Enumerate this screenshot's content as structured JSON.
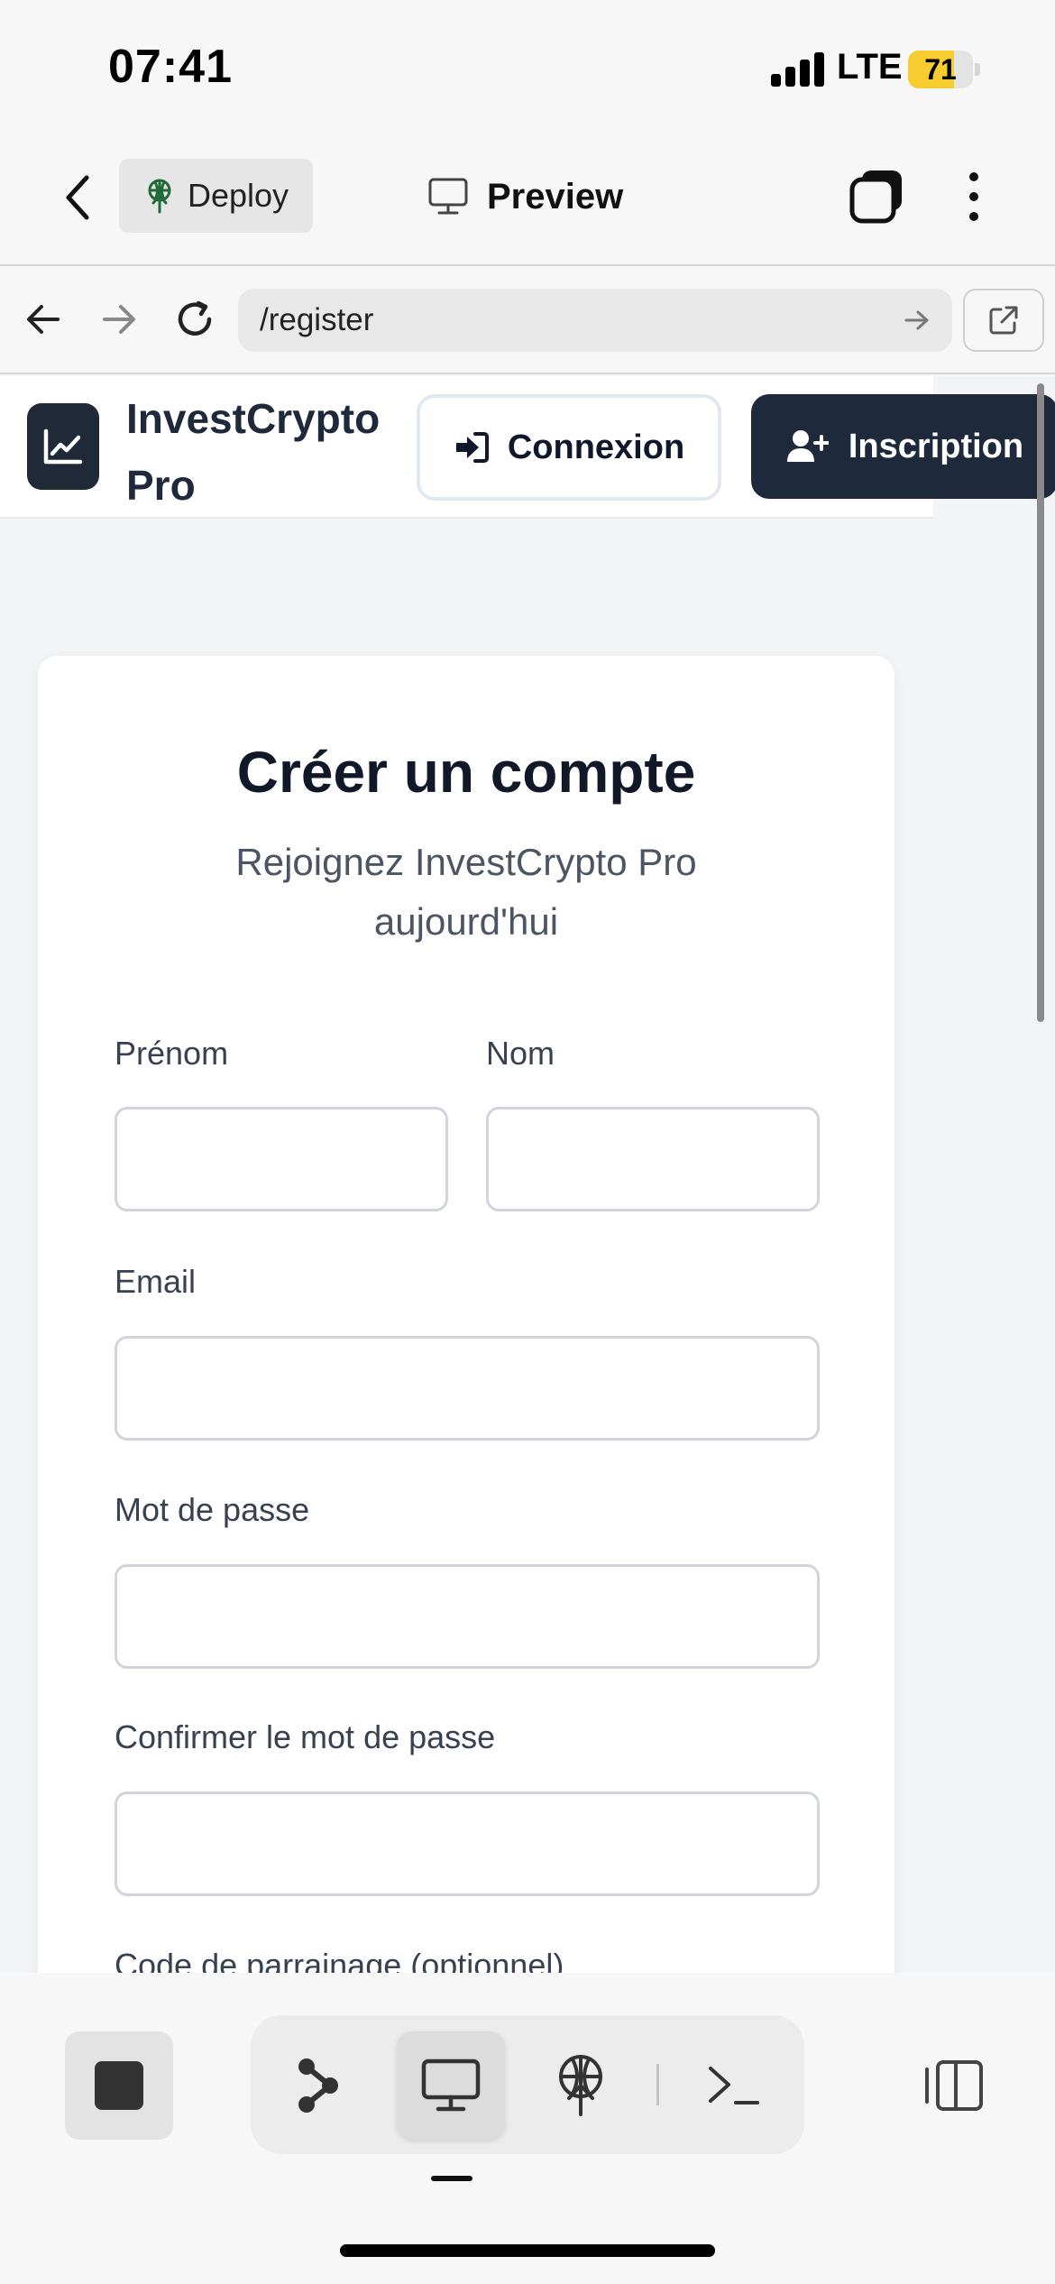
{
  "status_bar": {
    "time": "07:41",
    "network": "LTE",
    "battery_level": "71"
  },
  "app_header": {
    "deploy_label": "Deploy",
    "preview_label": "Preview"
  },
  "browser": {
    "url": "/register"
  },
  "site": {
    "brand_line1": "InvestCrypto",
    "brand_line2": "Pro",
    "login_label": "Connexion",
    "signup_label": "Inscription"
  },
  "form": {
    "title": "Créer un compte",
    "subtitle_line1": "Rejoignez InvestCrypto Pro",
    "subtitle_line2": "aujourd'hui",
    "first_name_label": "Prénom",
    "last_name_label": "Nom",
    "email_label": "Email",
    "password_label": "Mot de passe",
    "confirm_password_label": "Confirmer le mot de passe",
    "referral_label": "Code de parrainage (optionnel)",
    "first_name_value": "",
    "last_name_value": "",
    "email_value": "",
    "password_value": "",
    "confirm_password_value": ""
  },
  "colors": {
    "accent_dark": "#1e293b",
    "battery_yellow": "#f7cc2e",
    "deploy_icon_green": "#1f6b3a"
  },
  "icons": {
    "back": "chevron-left-icon",
    "deploy": "antenna-icon",
    "preview": "monitor-icon",
    "tabs": "tabs-icon",
    "more": "more-vertical-icon",
    "browser_back": "arrow-left-icon",
    "browser_forward": "arrow-right-icon",
    "reload": "reload-icon",
    "go": "arrow-right-icon",
    "external": "external-link-icon",
    "logo": "chart-line-icon",
    "login": "sign-in-icon",
    "signup": "user-plus-icon",
    "stop": "stop-icon",
    "git": "git-branch-icon",
    "terminal": "terminal-icon",
    "panel": "panel-icon"
  }
}
